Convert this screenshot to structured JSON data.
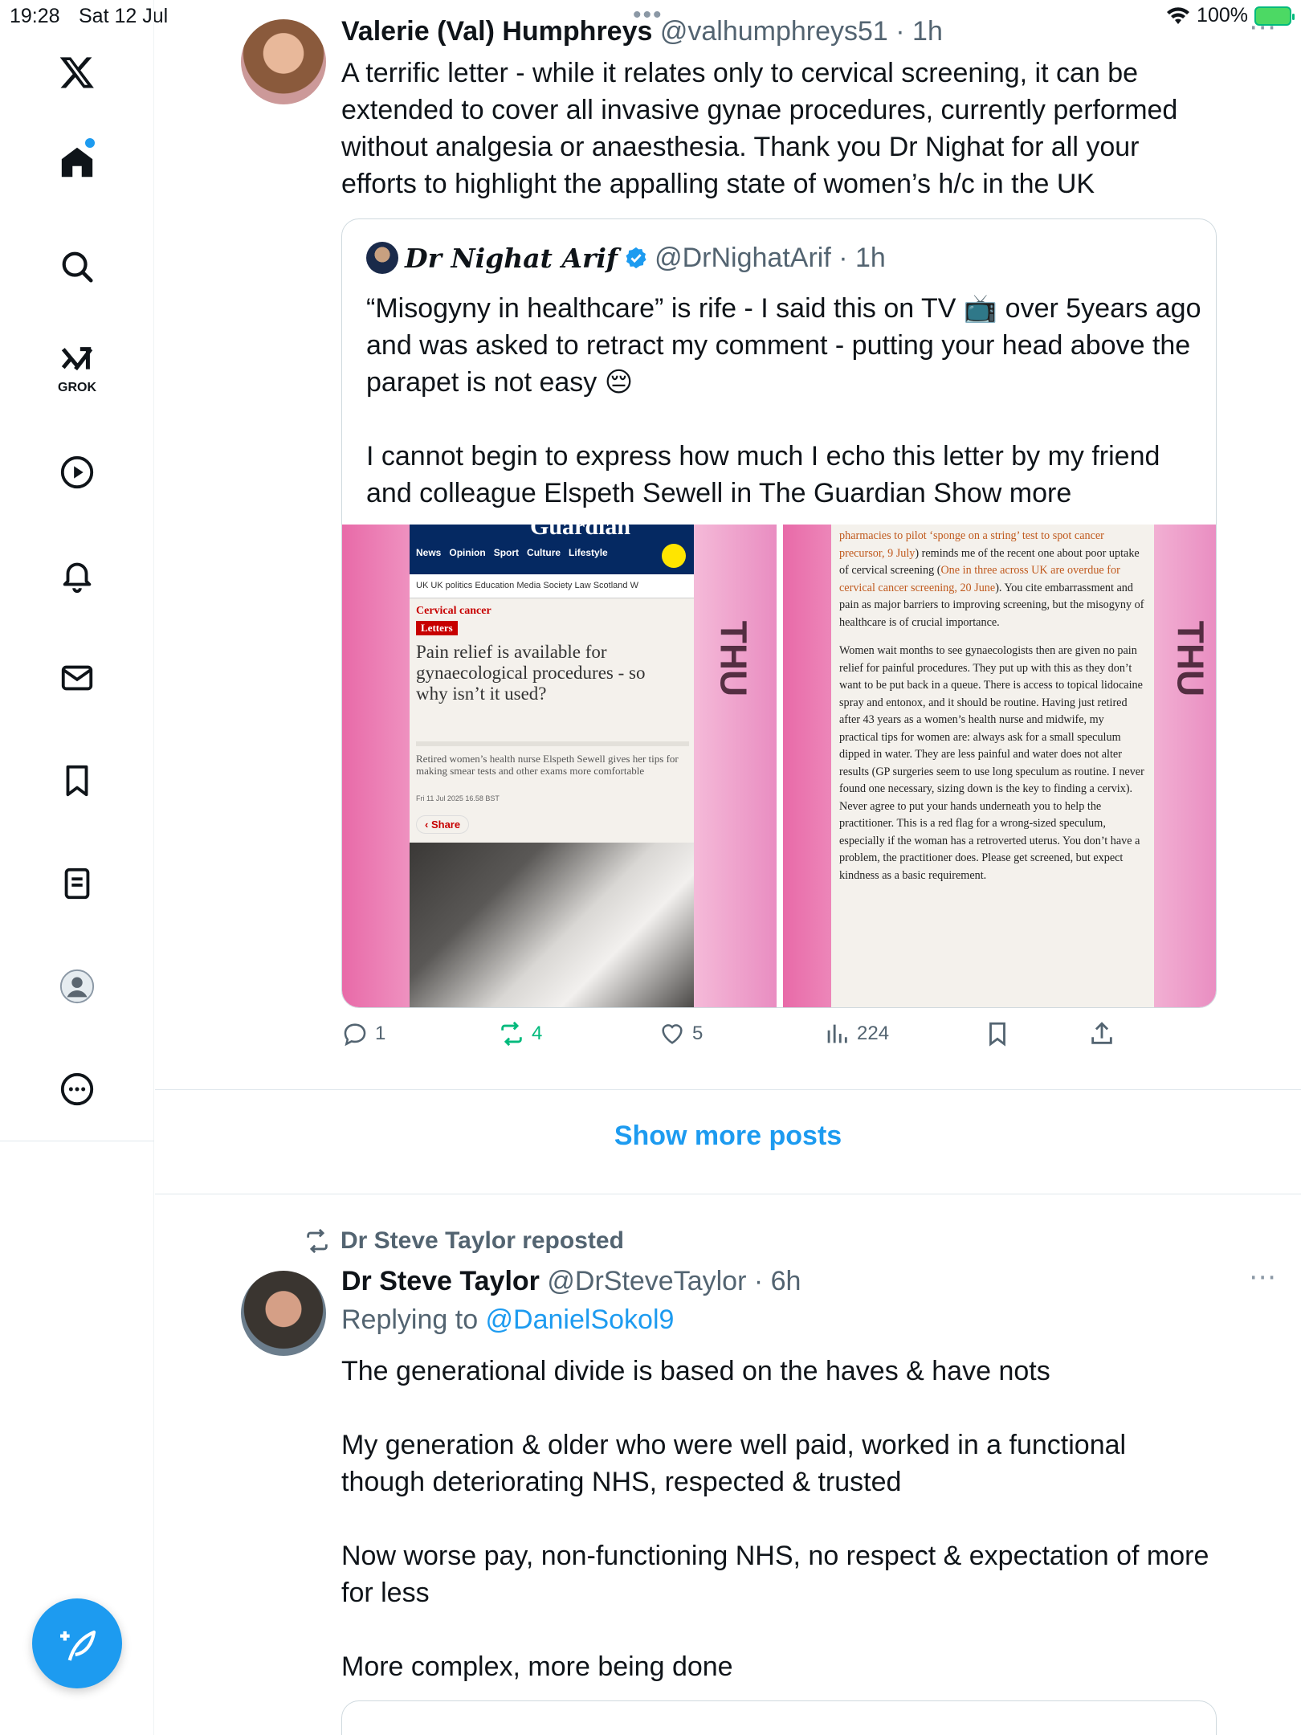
{
  "status_bar": {
    "time": "19:28",
    "date": "Sat 12 Jul",
    "battery": "100%"
  },
  "sidebar": {
    "items": [
      {
        "name": "x-logo"
      },
      {
        "name": "home"
      },
      {
        "name": "search"
      },
      {
        "name": "grok",
        "label": "GROK"
      },
      {
        "name": "video"
      },
      {
        "name": "notifications"
      },
      {
        "name": "messages"
      },
      {
        "name": "bookmarks"
      },
      {
        "name": "lists"
      },
      {
        "name": "profile"
      },
      {
        "name": "more"
      }
    ],
    "accent": "#1d9bf0"
  },
  "post1": {
    "name": "Valerie (Val) Humphreys",
    "handle_time": "@valhumphreys51 · 1h",
    "text": "A terrific letter - while it relates only to cervical screening, it can be extended to cover all invasive gynae procedures, currently performed without analgesia or anaesthesia. Thank you Dr Nighat for all your efforts to highlight the appalling state of women’s h/c in the UK",
    "quote": {
      "name": "Dr Nighat Arif",
      "handle_time": "@DrNighatArif · 1h",
      "text1": "“Misogyny in healthcare” is rife - I said this on TV 📺 over 5years ago and was asked to retract my comment - putting your head above the parapet is not easy 😔",
      "text2": " I cannot begin to express how much I echo this letter by my friend and colleague Elspeth Sewell in The Guardian ",
      "show_more": "Show more",
      "image_left": {
        "logo": "Guardian",
        "nav": [
          "News",
          "Opinion",
          "Sport",
          "Culture",
          "Lifestyle"
        ],
        "subnav": "UK  UK politics  Education  Media  Society  Law  Scotland  W",
        "kicker": "Cervical cancer",
        "tag": "Letters",
        "title": "Pain relief is available for gynaecological procedures - so why isn’t it used?",
        "standfirst": "Retired women’s health nurse Elspeth Sewell gives her tips for making smear tests and other exams more comfortable",
        "date": "Fri 11 Jul 2025 16.58 BST",
        "share": "Share"
      },
      "image_right": {
        "link1": "pharmacies to pilot ‘sponge on a string’ test to spot cancer precursor, 9 July",
        "text1": ") reminds me of the recent one about poor uptake of cervical screening (",
        "link2": "One in three across UK are overdue for cervical cancer screening, 20 June",
        "text2": "). You cite embarrassment and pain as major barriers to improving screening, but the misogyny of healthcare is of crucial importance.",
        "para2": "Women wait months to see gynaecologists then are given no pain relief for painful procedures. They put up with this as they don’t want to be put back in a queue. There is access to topical lidocaine spray and entonox, and it should be routine. Having just retired after 43 years as a women’s health nurse and midwife, my practical tips for women are: always ask for a small speculum dipped in water. They are less painful and water does not alter results (GP surgeries seem to use long speculum as routine. I never found one necessary, sizing down is the key to finding a cervix). Never agree to put your hands underneath you to help the practitioner. This is a red flag for a wrong-sized speculum, especially if the woman has a retroverted uterus. You don’t have a problem, the practitioner does. Please get screened, but expect kindness as a basic requirement."
      },
      "side_text": "THU"
    },
    "actions": {
      "replies": "1",
      "reposts": "4",
      "likes": "5",
      "views": "224"
    },
    "repost_color": "#00ba7c"
  },
  "show_more_posts": "Show more posts",
  "post2": {
    "repost_label": "Dr Steve Taylor reposted",
    "name": "Dr Steve Taylor",
    "handle_time": "@DrSteveTaylor · 6h",
    "replying_prefix": "Replying to ",
    "replying_to": "@DanielSokol9",
    "p1": "The generational divide is based on the haves & have nots",
    "p2": "My generation & older who were well paid, worked in a functional though deteriorating NHS, respected & trusted",
    "p3": "Now worse pay, non-functioning NHS, no respect & expectation of more for less",
    "p4": "More complex, more being done"
  }
}
